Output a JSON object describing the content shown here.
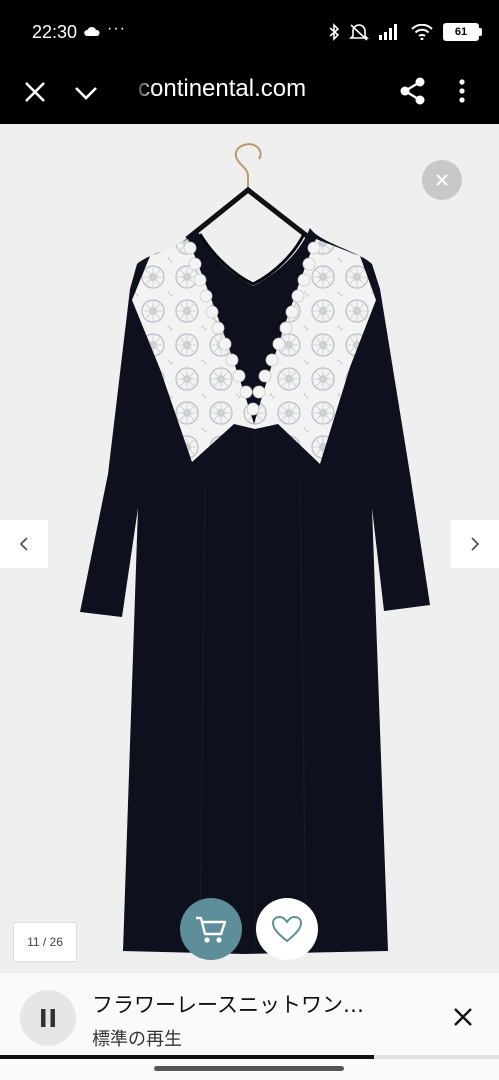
{
  "status_bar": {
    "time": "22:30",
    "dots": "···",
    "battery": "61",
    "icons": [
      "cloud-icon",
      "bluetooth-icon",
      "mute-icon",
      "signal-icon",
      "wifi-icon",
      "battery-icon"
    ]
  },
  "url_bar": {
    "domain": "continental.com",
    "icons": [
      "close-icon",
      "chevron-down-icon",
      "share-icon",
      "more-vert-icon"
    ]
  },
  "viewer": {
    "counter": "11 / 26",
    "icons": [
      "close-icon",
      "chevron-left-icon",
      "chevron-right-icon",
      "cart-icon",
      "heart-icon"
    ],
    "colors": {
      "cart_button": "#5e8e99",
      "dress": "#0e111d",
      "lace": "#f4f4f4",
      "background": "#efefef"
    }
  },
  "player": {
    "title": "フラワーレースニットワン…",
    "subtitle": "標準の再生",
    "progress": 0.75,
    "icons": [
      "pause-icon",
      "close-icon"
    ]
  }
}
